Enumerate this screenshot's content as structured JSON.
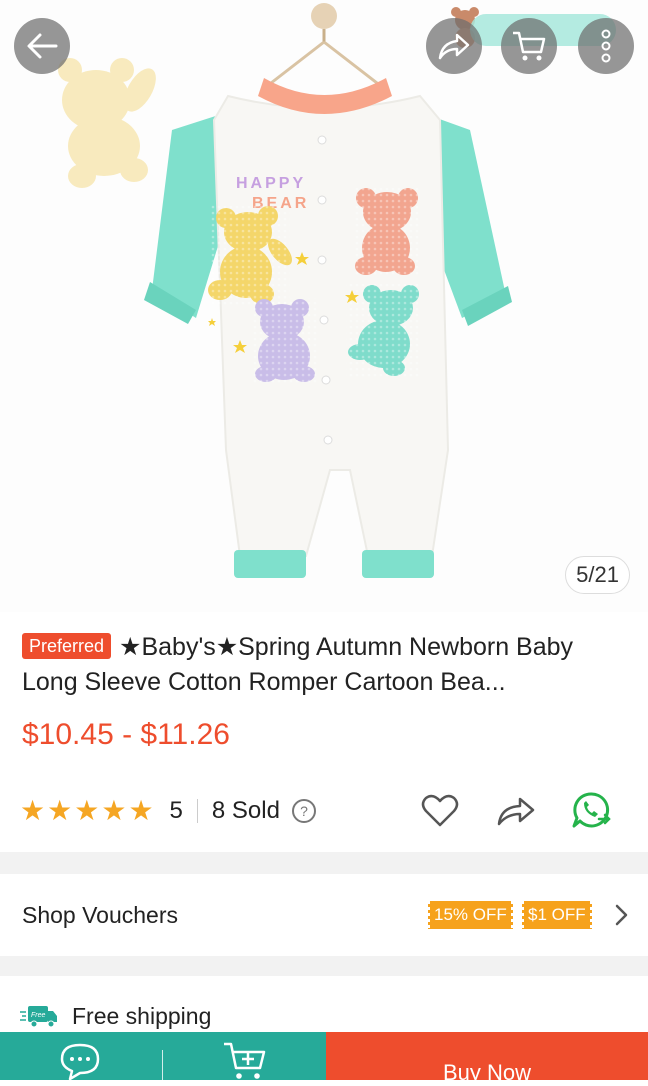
{
  "gallery": {
    "image_label": "Baby romper with bear print",
    "print_text_line1": "HAPPY",
    "print_text_line2": "BEAR",
    "counter": "5/21"
  },
  "product": {
    "badge": "Preferred",
    "title": "★Baby's★Spring Autumn Newborn Baby Long Sleeve Cotton Romper Cartoon Bea...",
    "price": "$10.45 - $11.26",
    "rating": "5",
    "rating_stars": 5,
    "sold": "8 Sold"
  },
  "vouchers": {
    "label": "Shop Vouchers",
    "tags": [
      "15% OFF",
      "$1 OFF"
    ]
  },
  "shipping": {
    "icon_badge": "Free",
    "label": "Free shipping"
  },
  "bottom_bar": {
    "buy_now": "Buy Now"
  },
  "colors": {
    "brand": "#ee4d2d",
    "teal": "#26aa99",
    "star": "#f5a623",
    "voucher": "#f6a21c"
  },
  "icons": [
    "back-arrow-icon",
    "share-icon",
    "cart-icon",
    "more-icon",
    "help-icon",
    "heart-icon",
    "share-icon",
    "whatsapp-icon",
    "chevron-right-icon",
    "truck-icon",
    "chat-icon",
    "add-to-cart-icon"
  ]
}
